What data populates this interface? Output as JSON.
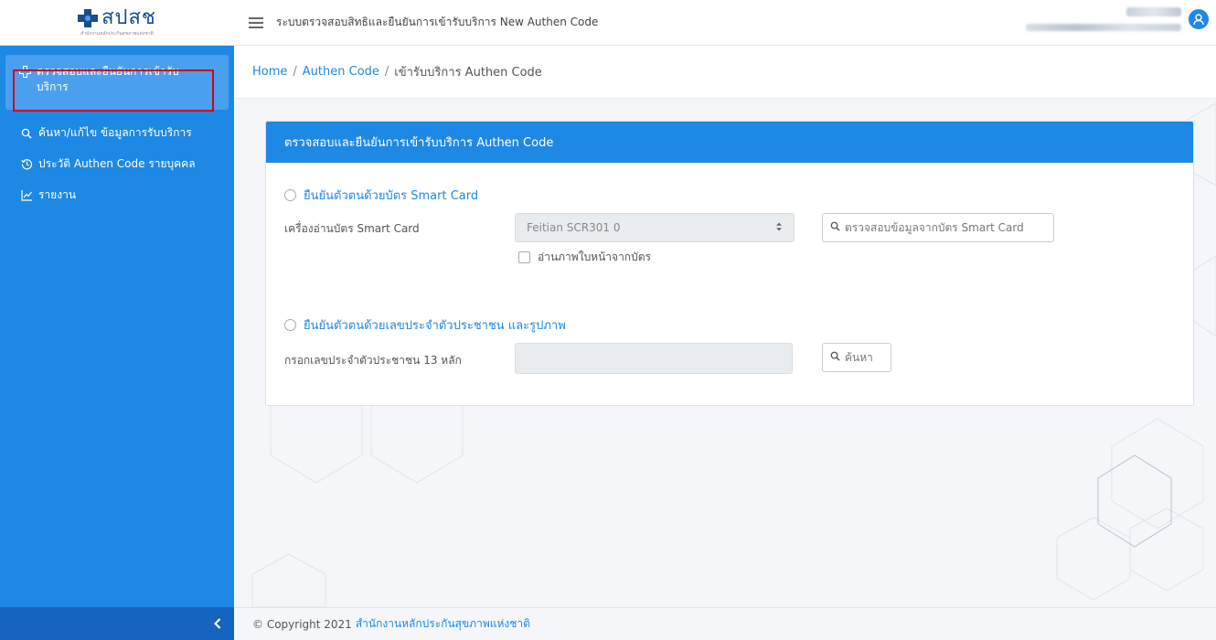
{
  "logo": {
    "text": "สปสช",
    "subtitle": "สำนักงานหลักประกันสุขภาพแห่งชาติ"
  },
  "header": {
    "title": "ระบบตรวจสอบสิทธิและยืนยันการเข้ารับบริการ New Authen Code"
  },
  "sidebar": {
    "items": [
      {
        "label": "ตรวจสอบและยืนยันการเข้ารับบริการ",
        "icon": "medical-cross-icon",
        "active": true
      },
      {
        "label": "ค้นหา/แก้ไข ข้อมูลการรับบริการ",
        "icon": "search-icon"
      },
      {
        "label": "ประวัติ Authen Code รายบุคคล",
        "icon": "history-icon"
      },
      {
        "label": "รายงาน",
        "icon": "chart-icon"
      }
    ],
    "collapse_icon": "chevron-left-icon"
  },
  "breadcrumb": [
    "Home",
    "Authen Code",
    "เข้ารับบริการ Authen Code"
  ],
  "card": {
    "title": "ตรวจสอบและยืนยันการเข้ารับบริการ Authen Code",
    "smartcard": {
      "radio_label": "ยืนยันตัวตนด้วยบัตร Smart Card",
      "reader_label": "เครื่องอ่านบัตร Smart Card",
      "reader_value": "Feitian SCR301 0",
      "read_button": "ตรวจสอบข้อมูลจากบัตร Smart Card",
      "checkbox_label": "อ่านภาพใบหน้าจากบัตร"
    },
    "idcard": {
      "radio_label": "ยืนยันตัวตนด้วยเลขประจำตัวประชาชน และรูปภาพ",
      "input_label": "กรอกเลขประจำตัวประชาชน 13 หลัก",
      "input_value": "",
      "search_button": "ค้นหา"
    }
  },
  "footer": {
    "copyright": "© Copyright 2021",
    "org": "สำนักงานหลักประกันสุขภาพแห่งชาติ"
  },
  "colors": {
    "primary": "#1e88e5",
    "active_menu": "#4aa0ef",
    "highlight": "#d0021b"
  }
}
